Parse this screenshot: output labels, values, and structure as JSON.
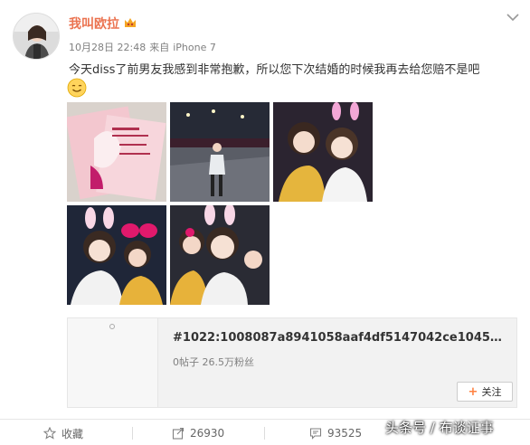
{
  "post": {
    "username": "我叫欧拉",
    "date": "10月28日 22:48",
    "source_prefix": "来自",
    "device": "iPhone 7",
    "text": "今天diss了前男友我感到非常抱歉，所以您下次结婚的时候我再去给您赔不是吧"
  },
  "icons": {
    "vip": "crown-badge-icon",
    "menu": "chevron-down-icon",
    "emoji": "smile-emoji-icon",
    "favorite": "star-icon",
    "repost": "share-icon",
    "comment": "comment-icon"
  },
  "topic": {
    "title": "#1022:1008087a8941058aaf4df5147042ce104568da#...",
    "stats": "0帖子  26.5万粉丝",
    "follow_label": "关注"
  },
  "actions": {
    "favorite_label": "收藏",
    "repost_count": "26930",
    "comment_count": "93525"
  },
  "watermark": "头条号 / 布谈证事",
  "colors": {
    "username": "#eb7350",
    "follow_plus": "#ff8140",
    "meta": "#808080"
  }
}
